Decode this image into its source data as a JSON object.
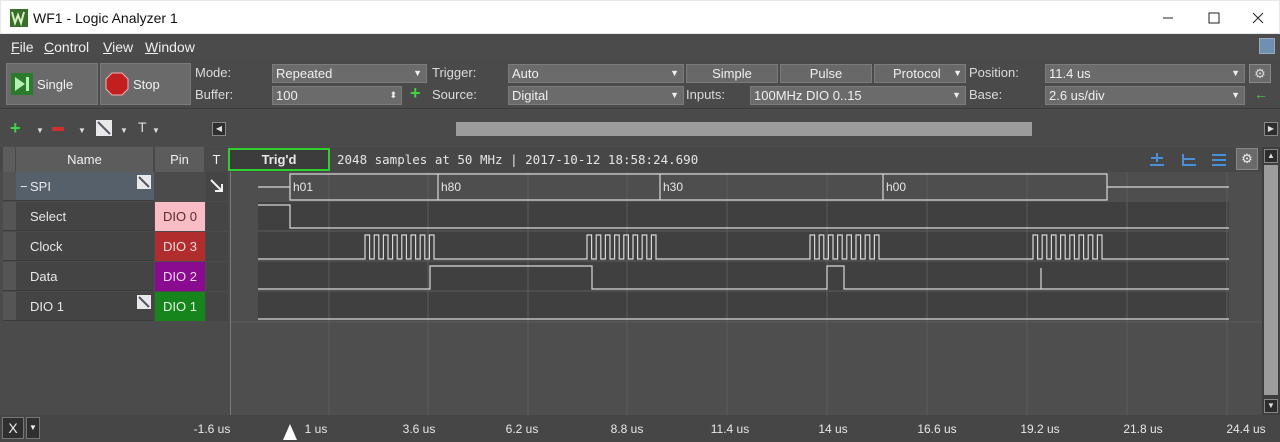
{
  "window": {
    "title": "WF1 - Logic Analyzer 1"
  },
  "menu": [
    "File",
    "Control",
    "View",
    "Window"
  ],
  "toolbar": {
    "single_label": "Single",
    "stop_label": "Stop",
    "mode_label": "Mode:",
    "mode_value": "Repeated",
    "buffer_label": "Buffer:",
    "buffer_value": "100",
    "trigger_label": "Trigger:",
    "trigger_value": "Auto",
    "source_label": "Source:",
    "source_value": "Digital",
    "simple_label": "Simple",
    "pulse_label": "Pulse",
    "protocol_label": "Protocol",
    "inputs_label": "Inputs:",
    "inputs_value": "100MHz DIO 0..15",
    "position_label": "Position:",
    "position_value": "11.4 us",
    "base_label": "Base:",
    "base_value": "2.6 us/div"
  },
  "toolbar2": {
    "add_icon": "plus-icon",
    "remove_icon": "minus-icon",
    "text_tool_label": "T"
  },
  "header": {
    "name_col": "Name",
    "pin_col": "Pin",
    "t_col": "T",
    "trig_status": "Trig'd",
    "info": "2048 samples at 50 MHz | 2017-10-12 18:58:24.690"
  },
  "channels": [
    {
      "name": "SPI",
      "pin": "",
      "pin_bg": "",
      "pin_fg": ""
    },
    {
      "name": "Select",
      "pin": "DIO 0",
      "pin_bg": "#f7bcc6",
      "pin_fg": "#5a2a2a"
    },
    {
      "name": "Clock",
      "pin": "DIO 3",
      "pin_bg": "#b12d2d",
      "pin_fg": "#f4dcdc"
    },
    {
      "name": "Data",
      "pin": "DIO 2",
      "pin_bg": "#8a0b8f",
      "pin_fg": "#f2d6f3"
    },
    {
      "name": "DIO 1",
      "pin": "DIO 1",
      "pin_bg": "#16861c",
      "pin_fg": "#e4f6e4"
    }
  ],
  "spi_values": [
    "h01",
    "h80",
    "h30",
    "h00"
  ],
  "timeline": {
    "x_label": "X",
    "ticks": [
      "-1.6 us",
      "1 us",
      "3.6 us",
      "6.2 us",
      "8.8 us",
      "11.4 us",
      "14 us",
      "16.6 us",
      "19.2 us",
      "21.8 us",
      "24.4 us"
    ]
  },
  "colors": {
    "trig_border": "#2fd12f",
    "wave_line": "#d8d8d8"
  }
}
